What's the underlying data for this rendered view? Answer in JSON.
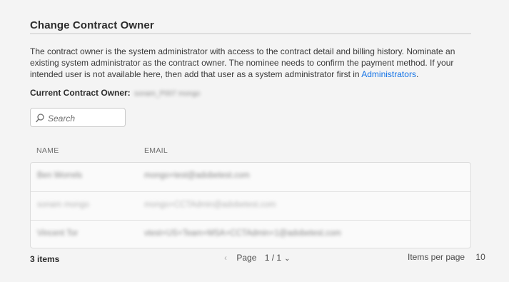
{
  "section": {
    "title": "Change Contract Owner",
    "description_main": "The contract owner is the system administrator with access to the contract detail and billing history. Nominate an existing system administrator as the contract owner. The nominee needs to confirm the payment method. If your intended user is not available here, then add that user as a system administrator first in ",
    "description_link": "Administrators",
    "description_end": "."
  },
  "current_owner": {
    "label": "Current Contract Owner:",
    "value": "sonam_P007 mongo"
  },
  "search": {
    "placeholder": "Search",
    "value": ""
  },
  "table": {
    "columns": [
      "NAME",
      "EMAIL"
    ],
    "rows": [
      {
        "name": "Ben Worrels",
        "email": "mongo+test@adobetest.com"
      },
      {
        "name": "sonam mongo",
        "email": "mongo+CCTAdmin@adobetest.com"
      },
      {
        "name": "Vincent Tor",
        "email": "vtest+US+Team+MSA+CCTAdmin+1@adobetest.com"
      }
    ]
  },
  "footer": {
    "count": "3 items",
    "page_label": "Page",
    "page_value": "1 / 1",
    "items_per_page_label": "Items per page",
    "items_per_page_value": "10"
  }
}
